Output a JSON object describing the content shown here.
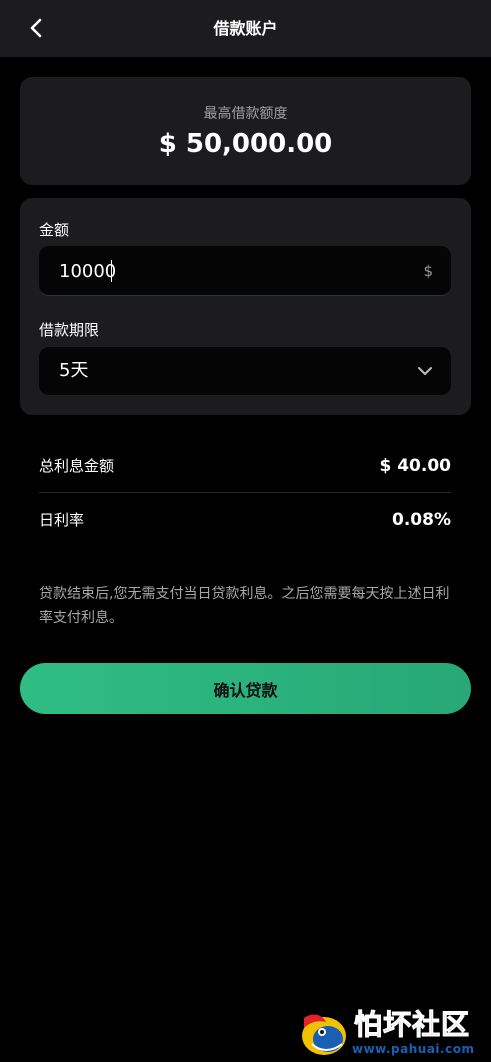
{
  "header": {
    "title": "借款账户",
    "back_icon": "chevron-left-icon"
  },
  "limit": {
    "label": "最高借款额度",
    "value": "$ 50,000.00"
  },
  "form": {
    "amount_label": "金额",
    "amount_value": "10000",
    "amount_suffix": "$",
    "term_label": "借款期限",
    "term_value": "5天",
    "term_icon": "chevron-down-icon"
  },
  "summary": {
    "interest_label": "总利息金额",
    "interest_value": "$ 40.00",
    "rate_label": "日利率",
    "rate_value": "0.08%"
  },
  "notice": "贷款结束后,您无需支付当日贷款利息。之后您需要每天按上述日利率支付利息。",
  "confirm_label": "确认贷款",
  "watermark": {
    "title": "怕坏社区",
    "url": "www.pahuai.com"
  },
  "colors": {
    "background": "#000000",
    "card": "#1c1c1e",
    "accent_start": "#2fbd84",
    "accent_end": "#27a876",
    "watermark_red": "#e4232b",
    "watermark_blue": "#1a5fb4"
  }
}
